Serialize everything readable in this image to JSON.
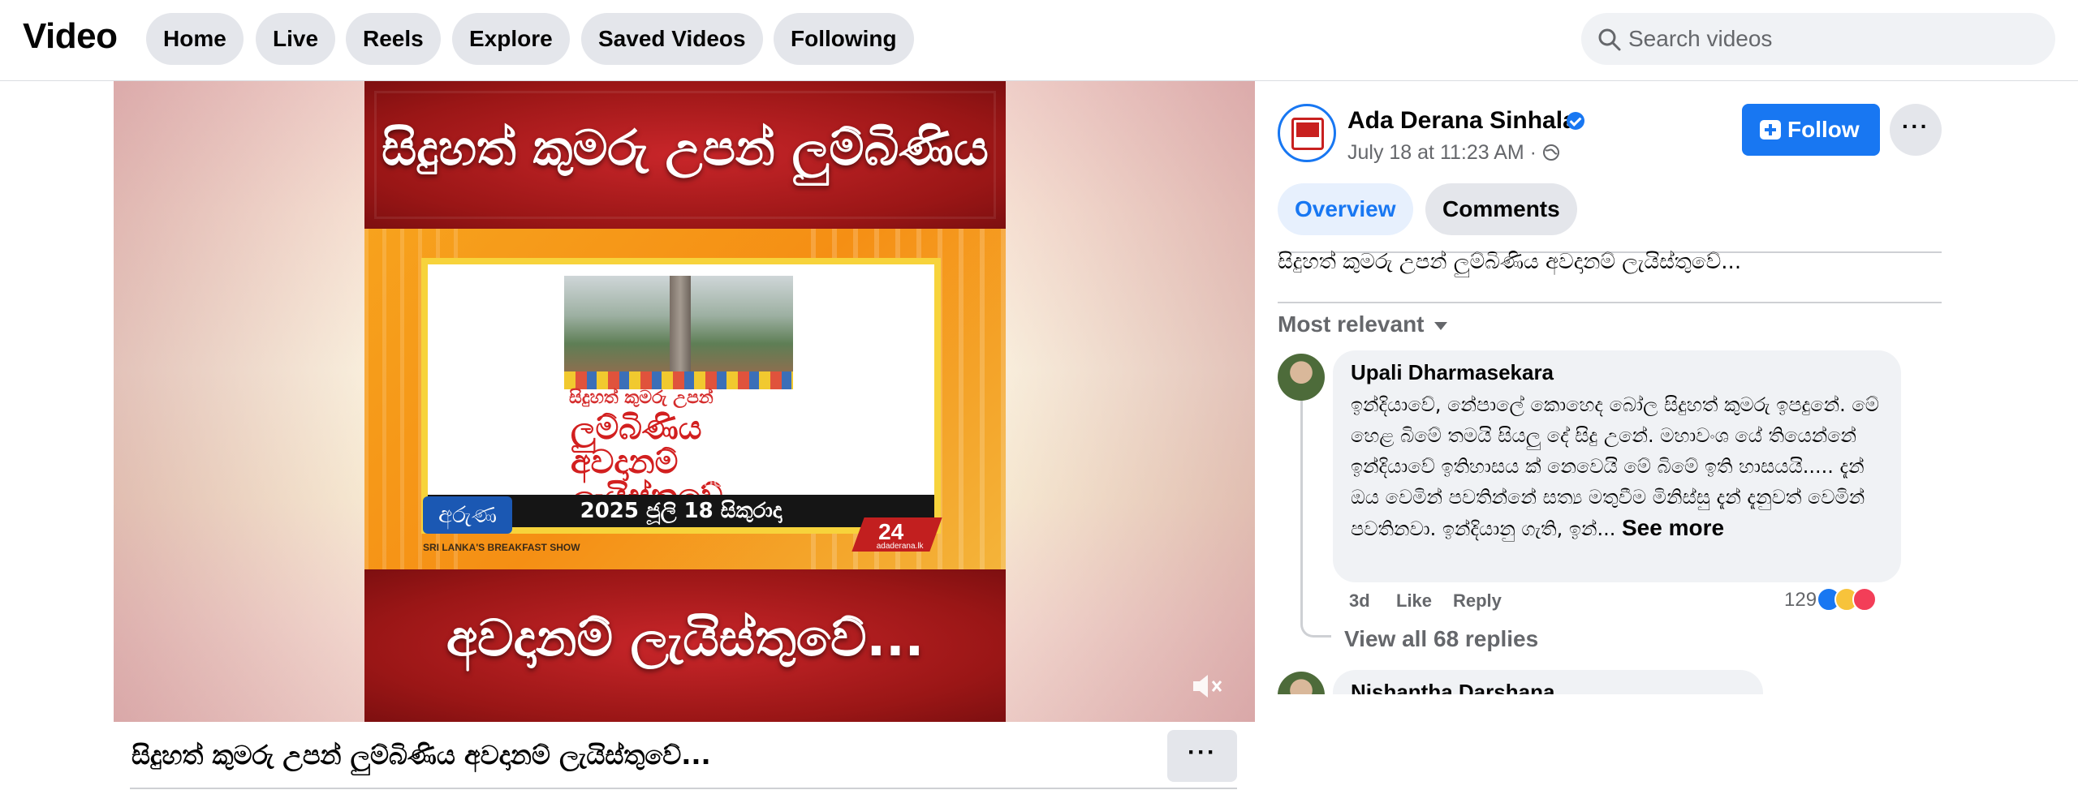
{
  "header": {
    "title": "Video",
    "nav": [
      "Home",
      "Live",
      "Reels",
      "Explore",
      "Saved Videos",
      "Following"
    ],
    "search_placeholder": "Search videos"
  },
  "video": {
    "banner_top": "සිදුහත් කුමරු උපන් ලුම්බිණිය",
    "banner_bottom": "අවදානම් ලැයිස්තුවේ...",
    "card_line1": "සිදුහත් කුමරු උපන්",
    "card_big": [
      "ලුම්බිණිය",
      "අවදානම්",
      "ලැයිස්තුවේ"
    ],
    "card_date": "2025 ජූලි 18 සිකුරාදා",
    "show_name": "අරුණ",
    "show_tagline": "SRI LANKA'S BREAKFAST SHOW",
    "logo_num": "24",
    "logo_site": "adaderana.lk",
    "watermark": "© adaderana",
    "title": "සිදුහත් කුමරු උපන් ලුම්බිණිය අවදානම් ලැයිස්තුවේ...",
    "more_label": "···"
  },
  "sidebar": {
    "channel": "Ada Derana Sinhala",
    "meta": "July 18 at 11:23 AM · ",
    "follow_label": "Follow",
    "more_label": "···",
    "tabs": [
      "Overview",
      "Comments"
    ],
    "description": "සිදුහත් කුමරු උපන් ලුම්බිණිය අවදානම් ලැයිස්තුවේ...",
    "sort_label": "Most relevant",
    "comments": [
      {
        "author": "Upali Dharmasekara",
        "text": "ඉන්දියාවේ, නේපාලේ කොහෙද බෝල සිදුහත් කුමරු ඉපදුනේ. මේ හෙළ බිමේ තමයි සියලු දේ සිදු උනේ. මහාවංශ යේ තියෙන්නේ ඉන්දියාවේ ඉතිහාසය ක් නෙවෙයි මේ බිමේ ඉති හාසයයි..... දැන් ඔය වෙමින් පවතින්නේ සත්‍ය මතුවීම මිනිස්සු දැන් දැනුවත් වෙමින් පවතිනවා. ඉන්දියානු ගැති, ඉන්...",
        "see_more": "See more",
        "age": "3d",
        "like": "Like",
        "reply": "Reply",
        "reactions": "129",
        "view_replies": "View all 68 replies"
      },
      {
        "author": "Nishantha Darshana"
      }
    ]
  },
  "colors": {
    "accent": "#1877f2",
    "banner_red": "#9a1616",
    "orange": "#f7a21d"
  }
}
